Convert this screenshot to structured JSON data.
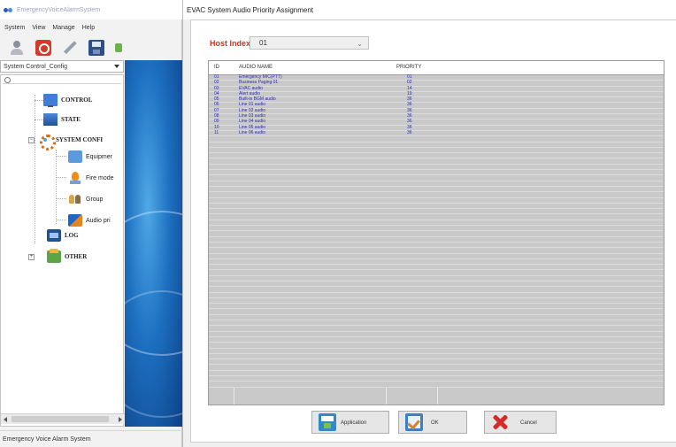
{
  "main_window": {
    "title": "EmergencyVoiceAlarmSystem",
    "menu": [
      "System",
      "View",
      "Manage",
      "Help"
    ],
    "tree_selector": "System Control_Config",
    "tree_items": [
      {
        "label": "CONTROL",
        "icon": "monitor-icon"
      },
      {
        "label": "STATE",
        "icon": "state-icon"
      },
      {
        "label": "SYSTEM CONFI",
        "icon": "gear-icon"
      },
      {
        "label": "Equipmer",
        "icon": "equipment-icon"
      },
      {
        "label": "Fire mode",
        "icon": "fire-icon"
      },
      {
        "label": "Group",
        "icon": "group-icon"
      },
      {
        "label": "Audio pri",
        "icon": "audio-priority-icon"
      },
      {
        "label": "LOG",
        "icon": "log-icon"
      },
      {
        "label": "OTHER",
        "icon": "other-icon"
      }
    ],
    "status": "Emergency Voice Alarm System"
  },
  "dialog": {
    "title": "EVAC System Audio Priority Assignment",
    "host_index_label": "Host Index",
    "host_index_value": "01",
    "columns": [
      "ID",
      "AUDIO NAME",
      "PRIORITY"
    ],
    "rows": [
      {
        "id": "01",
        "name": "Emergency MIC(PTT)",
        "priority": "01"
      },
      {
        "id": "02",
        "name": "Business Paging 01",
        "priority": "02"
      },
      {
        "id": "03",
        "name": "EVAC audio",
        "priority": "14"
      },
      {
        "id": "04",
        "name": "Alert audio",
        "priority": "19"
      },
      {
        "id": "05",
        "name": "Built-in BGM audio",
        "priority": "36"
      },
      {
        "id": "06",
        "name": "Line 01 audio",
        "priority": "36"
      },
      {
        "id": "07",
        "name": "Line 02 audio",
        "priority": "36"
      },
      {
        "id": "08",
        "name": "Line 03 audio",
        "priority": "36"
      },
      {
        "id": "09",
        "name": "Line 04 audio",
        "priority": "36"
      },
      {
        "id": "10",
        "name": "Line 05 audio",
        "priority": "36"
      },
      {
        "id": "11",
        "name": "Line 06 audio",
        "priority": "36"
      }
    ],
    "buttons": {
      "apply": "Application",
      "ok": "OK",
      "cancel": "Cancel"
    }
  }
}
